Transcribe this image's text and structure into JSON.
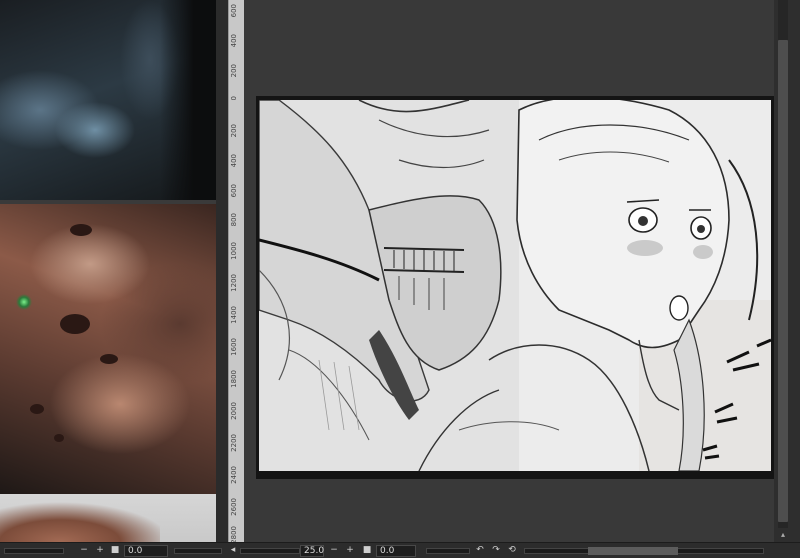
{
  "rulers": {
    "vertical_labels": [
      "600",
      "400",
      "200",
      "0",
      "200",
      "400",
      "600",
      "800",
      "1000",
      "1200",
      "1400",
      "1600",
      "1800",
      "2000",
      "2200",
      "2400",
      "2600",
      "2800"
    ]
  },
  "reference_panel": {
    "zoom_value": "0.0",
    "minus": "−",
    "plus": "+",
    "rotate_value": "0.0"
  },
  "canvas_status": {
    "left_arrow": "◂",
    "minus": "−",
    "plus": "+",
    "zoom_value": "25.0",
    "rotate_value": "0.0",
    "flip_h_icon": "↶",
    "flip_v_icon": "↷",
    "reset_icon": "⟲"
  },
  "scroll": {
    "up_arrow": "▴"
  },
  "colors": {
    "app_background": "#383838",
    "ruler": "#c8c8c8",
    "artboard_frame": "#141414",
    "artwork_paper": "#efefef",
    "statusbar": "#2c2c2c"
  }
}
